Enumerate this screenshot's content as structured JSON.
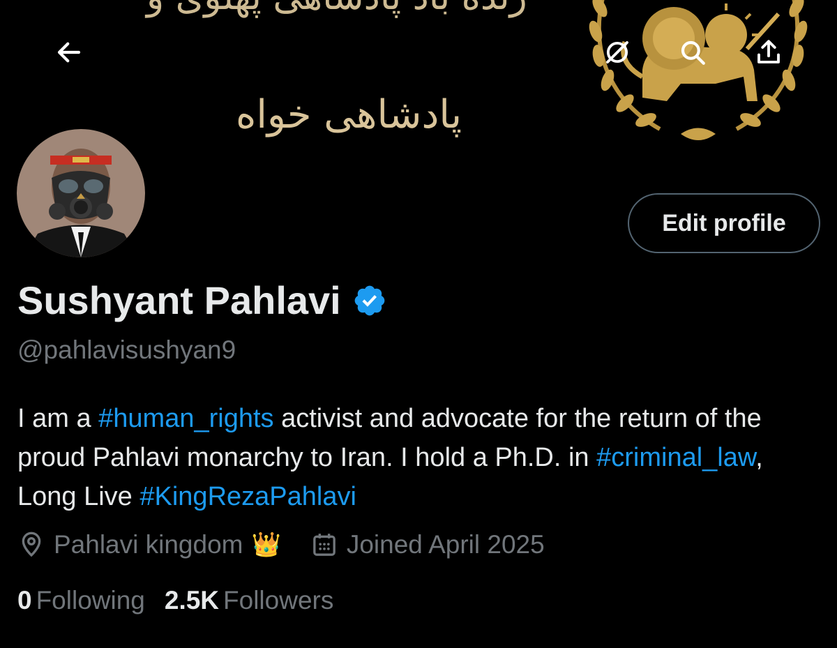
{
  "banner": {
    "script_top": "زنده باد پادشاهی پهلوی و",
    "script_mid": "پادشاهی خواه"
  },
  "header": {
    "back_icon": "arrow-left-icon",
    "actions": [
      "mute-icon",
      "search-icon",
      "share-icon"
    ]
  },
  "profile": {
    "name": "Sushyant Pahlavi",
    "handle": "@pahlavisushyan9",
    "verified": true,
    "edit_button": "Edit profile",
    "bio": {
      "p1": "I am a ",
      "tag1": "#human_rights",
      "p2": " activist and advocate for the return of the proud Pahlavi monarchy to Iran. I hold a Ph.D. in ",
      "tag2": "#criminal_law",
      "p3": ", Long Live ",
      "tag3": "#KingRezaPahlavi"
    },
    "location": "Pahlavi kingdom",
    "location_emoji": "👑",
    "joined": "Joined April 2025",
    "following_count": "0",
    "following_label": "Following",
    "followers_count": "2.5K",
    "followers_label": "Followers"
  },
  "colors": {
    "background": "#000000",
    "text": "#e7e9ea",
    "muted": "#71767b",
    "link": "#1d9bf0",
    "verified": "#1d9bf0",
    "banner_gold": "#d9c49a"
  }
}
